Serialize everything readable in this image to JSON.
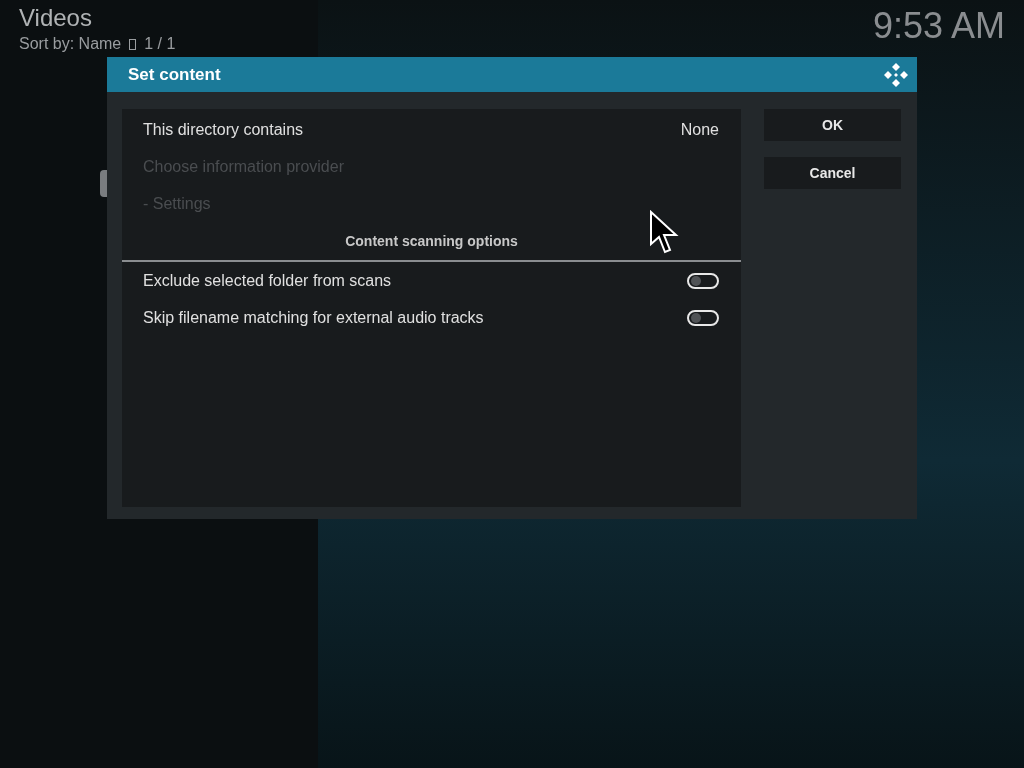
{
  "header": {
    "title": "Videos",
    "sort": "Sort by: Name",
    "count": "1 / 1"
  },
  "clock": "9:53 AM",
  "dialog": {
    "title": "Set content",
    "items": [
      {
        "kind": "setting",
        "label": "This directory contains",
        "value": "None",
        "disabled": false
      },
      {
        "kind": "setting",
        "label": "Choose information provider",
        "disabled": true
      },
      {
        "kind": "setting",
        "label": "- Settings",
        "disabled": true
      },
      {
        "kind": "header",
        "label": "Content scanning options"
      },
      {
        "kind": "toggle",
        "label": "Exclude selected folder from scans",
        "on": false
      },
      {
        "kind": "toggle",
        "label": "Skip filename matching for external audio tracks",
        "on": false
      }
    ],
    "buttons": [
      "OK",
      "Cancel"
    ]
  }
}
